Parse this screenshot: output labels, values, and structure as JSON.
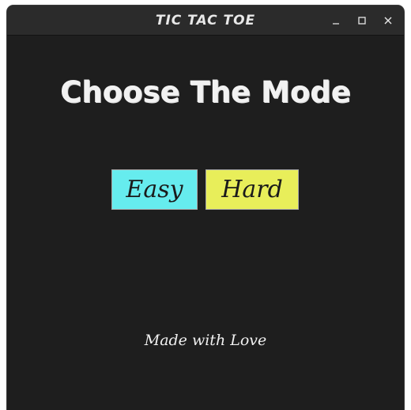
{
  "window": {
    "title": "TIC TAC TOE",
    "controls": [
      "minimize-icon",
      "maximize-icon",
      "close-icon"
    ]
  },
  "main": {
    "heading": "Choose The Mode",
    "easy_label": "Easy",
    "hard_label": "Hard",
    "footer": "Made with Love"
  },
  "colors": {
    "background": "#1e1e1e",
    "easy": "#66ecee",
    "hard": "#e8ee5a",
    "text": "#f2f2f2"
  }
}
